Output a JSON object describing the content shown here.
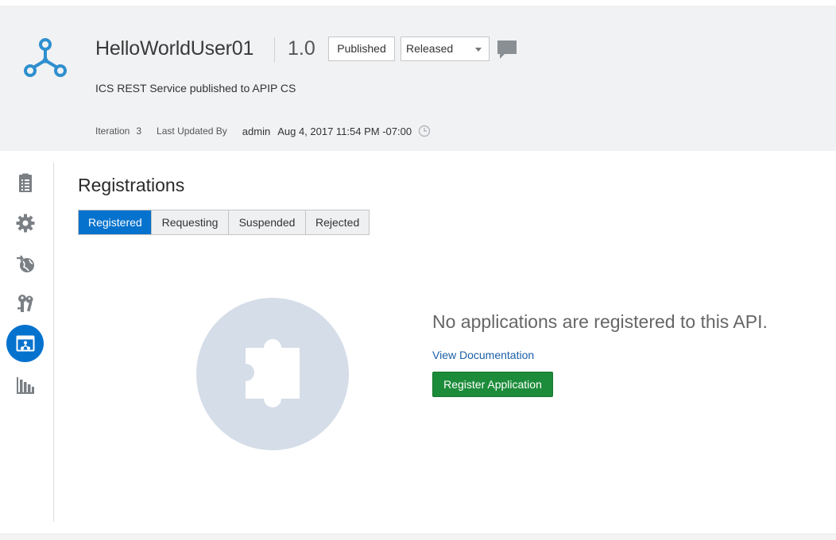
{
  "header": {
    "title": "HelloWorldUser01",
    "version": "1.0",
    "state_badge": "Published",
    "status_select": {
      "selected": "Released"
    },
    "description": "ICS REST Service published to APIP CS",
    "iteration_label": "Iteration",
    "iteration_value": "3",
    "last_updated_label": "Last Updated By",
    "last_updated_user": "admin",
    "last_updated_date": "Aug 4, 2017 11:54 PM -07:00",
    "icons": {
      "logo": "api-logo-icon",
      "comment": "comment-icon",
      "clock": "clock-icon"
    }
  },
  "sidebar": {
    "items": [
      {
        "icon": "document-list-icon",
        "active": false
      },
      {
        "icon": "gear-icon",
        "active": false
      },
      {
        "icon": "globe-deploy-icon",
        "active": false
      },
      {
        "icon": "keys-icon",
        "active": false
      },
      {
        "icon": "registrations-icon",
        "active": true
      },
      {
        "icon": "analytics-chart-icon",
        "active": false
      }
    ]
  },
  "main": {
    "section_title": "Registrations",
    "tabs": [
      {
        "label": "Registered",
        "active": true
      },
      {
        "label": "Requesting",
        "active": false
      },
      {
        "label": "Suspended",
        "active": false
      },
      {
        "label": "Rejected",
        "active": false
      }
    ],
    "empty_message": "No applications are registered to this API.",
    "doc_link": "View Documentation",
    "register_button": "Register Application",
    "illustration_icon": "puzzle-piece-icon"
  },
  "colors": {
    "accent": "#0572ce",
    "primary_action": "#1c8c3a",
    "header_bg": "#f1f2f3",
    "icon_gray": "#7a7f84",
    "logo_blue": "#2f8fcf",
    "link": "#1a5fa6"
  }
}
